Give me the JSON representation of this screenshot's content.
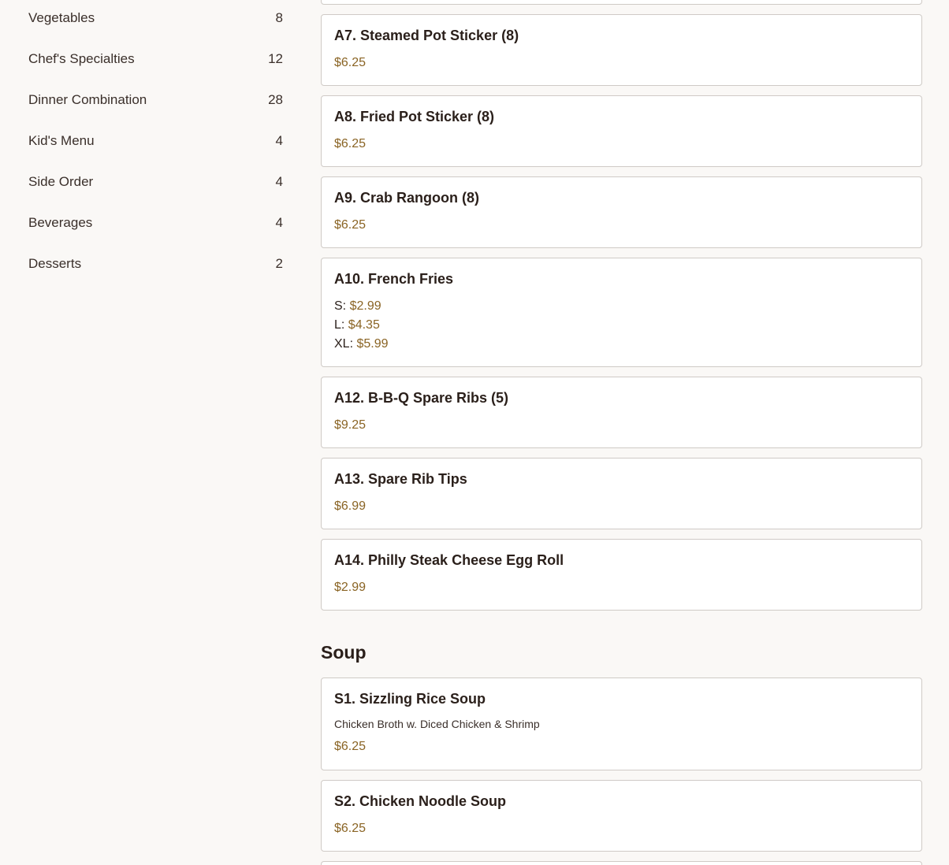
{
  "sidebar": {
    "categories": [
      {
        "label": "Vegetables",
        "count": "8"
      },
      {
        "label": "Chef's Specialties",
        "count": "12"
      },
      {
        "label": "Dinner Combination",
        "count": "28"
      },
      {
        "label": "Kid's Menu",
        "count": "4"
      },
      {
        "label": "Side Order",
        "count": "4"
      },
      {
        "label": "Beverages",
        "count": "4"
      },
      {
        "label": "Desserts",
        "count": "2"
      }
    ]
  },
  "menu": {
    "items": [
      {
        "title": "A7. Steamed Pot Sticker (8)",
        "price": "$6.25"
      },
      {
        "title": "A8. Fried Pot Sticker (8)",
        "price": "$6.25"
      },
      {
        "title": "A9. Crab Rangoon (8)",
        "price": "$6.25"
      },
      {
        "title": "A10. French Fries",
        "sizes": [
          {
            "label": "S:",
            "price": "$2.99"
          },
          {
            "label": "L:",
            "price": "$4.35"
          },
          {
            "label": "XL:",
            "price": "$5.99"
          }
        ]
      },
      {
        "title": "A12. B-B-Q Spare Ribs (5)",
        "price": "$9.25"
      },
      {
        "title": "A13. Spare Rib Tips",
        "price": "$6.99"
      },
      {
        "title": "A14. Philly Steak Cheese Egg Roll",
        "price": "$2.99"
      }
    ],
    "soup_heading": "Soup",
    "soup_items": [
      {
        "title": "S1. Sizzling Rice Soup",
        "description": "Chicken Broth w. Diced Chicken & Shrimp",
        "price": "$6.25"
      },
      {
        "title": "S2. Chicken Noodle Soup",
        "price": "$6.25"
      }
    ]
  },
  "colors": {
    "price": "#8a6424",
    "background": "#faf8f6",
    "card_border": "#cfcac6"
  }
}
